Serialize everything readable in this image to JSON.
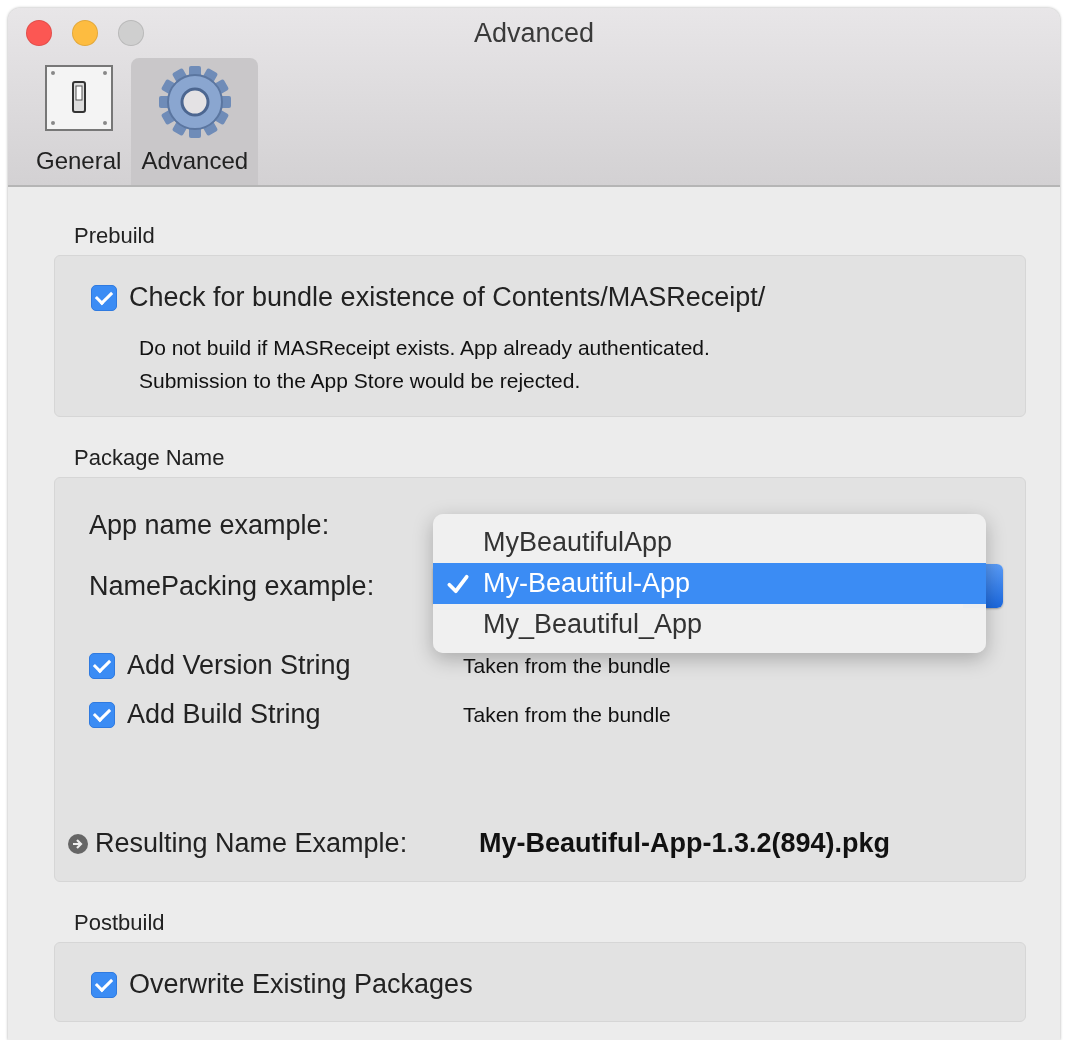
{
  "window": {
    "title": "Advanced",
    "traffic_lights": [
      {
        "kind": "close",
        "disabled": false
      },
      {
        "kind": "minimize",
        "disabled": false
      },
      {
        "kind": "zoom",
        "disabled": true
      }
    ]
  },
  "toolbar": [
    {
      "kind": "switch",
      "label": "General",
      "selected": false
    },
    {
      "kind": "gear",
      "label": "Advanced",
      "selected": true
    }
  ],
  "prebuild": {
    "title": "Prebuild",
    "option": {
      "label": "Check for bundle existence of Contents/MASReceipt/",
      "checked": true
    },
    "description": "Do not build if MASReceipt exists. App already authenticated.\nSubmission to the App Store would be rejected."
  },
  "package_name": {
    "title": "Package Name",
    "app_name_label": "App name example:",
    "name_packing_label": "NamePacking example:",
    "menu": [
      {
        "label": "MyBeautifulApp",
        "selected": false
      },
      {
        "label": "My-Beautiful-App",
        "selected": true
      },
      {
        "label": "My_Beautiful_App",
        "selected": false
      }
    ],
    "options": [
      {
        "label": "Add Version String",
        "checked": true,
        "note": "Taken from the bundle"
      },
      {
        "label": "Add Build String",
        "checked": true,
        "note": "Taken from the bundle"
      }
    ],
    "result_label": "Resulting Name Example:",
    "result_value": "My-Beautiful-App-1.3.2(894).pkg"
  },
  "postbuild": {
    "title": "Postbuild",
    "option": {
      "label": "Overwrite Existing Packages",
      "checked": true
    }
  }
}
